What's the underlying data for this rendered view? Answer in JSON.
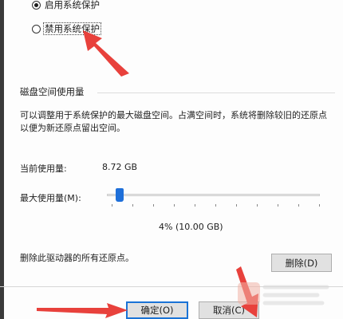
{
  "system_protection": {
    "option_enable": "启用系统保护",
    "option_disable": "禁用系统保护"
  },
  "disk_usage": {
    "group_title": "磁盘空间使用量",
    "description_line1": "可以调整用于系统保护的最大磁盘空间。占满空间时，系统将删除较旧的还原点",
    "description_line2": "以便为新还原点留出空间。",
    "current_usage_label": "当前使用量:",
    "current_usage_value": "8.72 GB",
    "max_usage_label": "最大使用量(M):",
    "max_usage_fraction": 0.04,
    "max_usage_text": "4% (10.00 GB)"
  },
  "restore_points": {
    "delete_label": "删除此驱动器的所有还原点。",
    "delete_button": "删除(D)"
  },
  "footer": {
    "ok_button": "确定(O)",
    "cancel_button": "取消(C)"
  },
  "colors": {
    "annotation_arrow": "#e8413c",
    "slider_thumb": "#1e6fd9",
    "focus_border": "#1a73d6"
  }
}
